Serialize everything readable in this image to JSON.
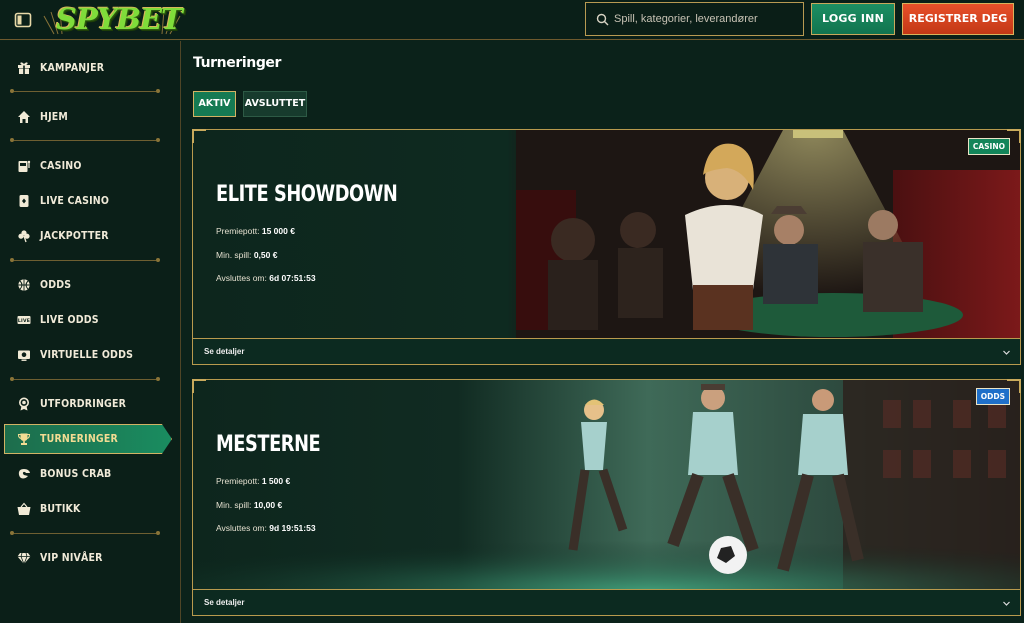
{
  "header": {
    "logo_text": "SPYBET",
    "search_placeholder": "Spill, kategorier, leverandører",
    "login_label": "LOGG INN",
    "register_label": "REGISTRER DEG"
  },
  "sidebar": {
    "items": [
      {
        "label": "KAMPANJER",
        "icon": "gift-icon"
      },
      {
        "label": "HJEM",
        "icon": "home-icon"
      },
      {
        "label": "CASINO",
        "icon": "slot-machine-icon"
      },
      {
        "label": "LIVE CASINO",
        "icon": "playing-card-icon"
      },
      {
        "label": "JACKPOTTER",
        "icon": "clover-icon"
      },
      {
        "label": "ODDS",
        "icon": "basketball-icon"
      },
      {
        "label": "LIVE ODDS",
        "icon": "live-icon"
      },
      {
        "label": "VIRTUELLE ODDS",
        "icon": "virtual-tv-icon"
      },
      {
        "label": "UTFORDRINGER",
        "icon": "medal-icon"
      },
      {
        "label": "TURNERINGER",
        "icon": "trophy-icon",
        "active": true
      },
      {
        "label": "BONUS CRAB",
        "icon": "crab-claw-icon"
      },
      {
        "label": "BUTIKK",
        "icon": "basket-icon"
      },
      {
        "label": "VIP NIVÅER",
        "icon": "diamond-icon"
      }
    ]
  },
  "main": {
    "title": "Turneringer",
    "tabs": [
      {
        "label": "AKTIV",
        "active": true
      },
      {
        "label": "AVSLUTTET",
        "active": false
      }
    ],
    "tournaments": [
      {
        "title": "ELITE SHOWDOWN",
        "badge": "CASINO",
        "badge_color": "#13855a",
        "prize_label": "Premiepott:",
        "prize_value": "15 000 €",
        "min_bet_label": "Min. spill:",
        "min_bet_value": "0,50 €",
        "ends_label": "Avsluttes om:",
        "ends_value": "6d 07:51:53",
        "details_label": "Se detaljer"
      },
      {
        "title": "MESTERNE",
        "badge": "ODDS",
        "badge_color": "#1f6fc9",
        "prize_label": "Premiepott:",
        "prize_value": "1 500 €",
        "min_bet_label": "Min. spill:",
        "min_bet_value": "10,00 €",
        "ends_label": "Avsluttes om:",
        "ends_value": "9d 19:51:53",
        "details_label": "Se detaljer"
      }
    ]
  },
  "colors": {
    "background": "#0b221a",
    "accent_gold": "#c9aa5c",
    "login_green": "#1c8f63",
    "register_orange": "#e8502a"
  }
}
